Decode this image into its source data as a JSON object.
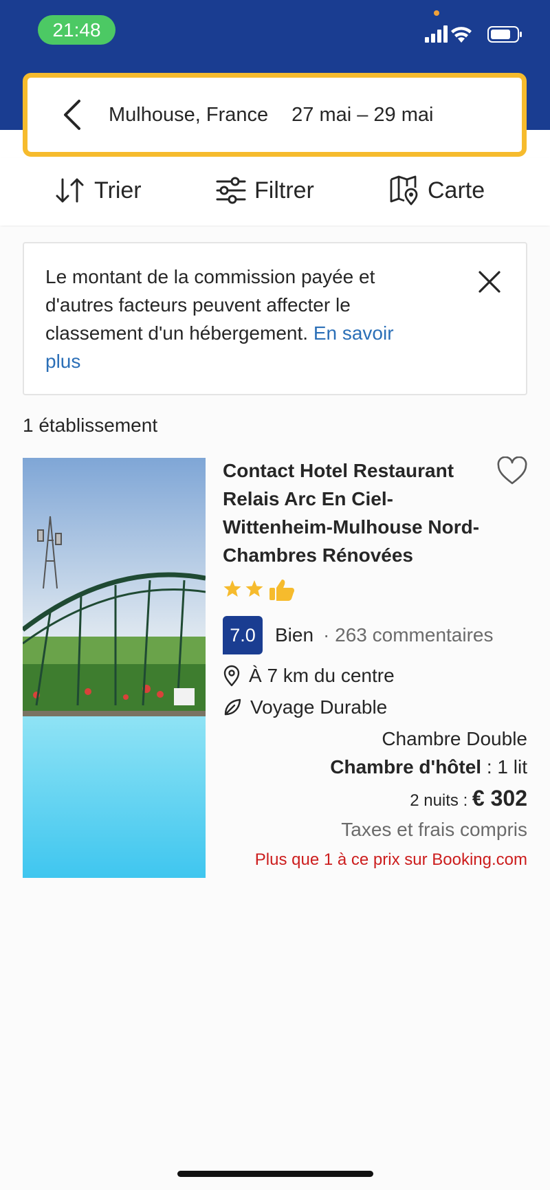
{
  "status_bar": {
    "time": "21:48"
  },
  "search": {
    "destination": "Mulhouse, France",
    "dates": "27 mai  –  29 mai"
  },
  "toolbar": {
    "sort_label": "Trier",
    "filter_label": "Filtrer",
    "map_label": "Carte"
  },
  "notice": {
    "text": "Le montant de la commission payée et d'autres facteurs peuvent affecter le classement d'un hébergement. ",
    "link": "En savoir plus"
  },
  "results": {
    "count": "1 établissement"
  },
  "hotel": {
    "name": "Contact Hotel Restaurant Relais Arc En Ciel-Wittenheim-Mulhouse Nord-Chambres Rénovées",
    "stars": 2,
    "score": "7.0",
    "score_word": "Bien",
    "reviews": "· 263 commentaires",
    "distance": "À 7 km du centre",
    "sustainability": "Voyage Durable",
    "room_type": "Chambre Double",
    "bed_label": "Chambre d'hôtel",
    "bed_detail": " : 1 lit",
    "nights": "2 nuits : ",
    "price": "€ 302",
    "taxes": "Taxes et frais compris",
    "scarcity": "Plus que 1 à ce prix sur Booking.com"
  },
  "colors": {
    "brand_blue": "#1a3d91",
    "search_border": "#f6bb2d",
    "link": "#2b6fb7",
    "scarcity": "#cc1d1d",
    "status_green": "#4cc964"
  }
}
